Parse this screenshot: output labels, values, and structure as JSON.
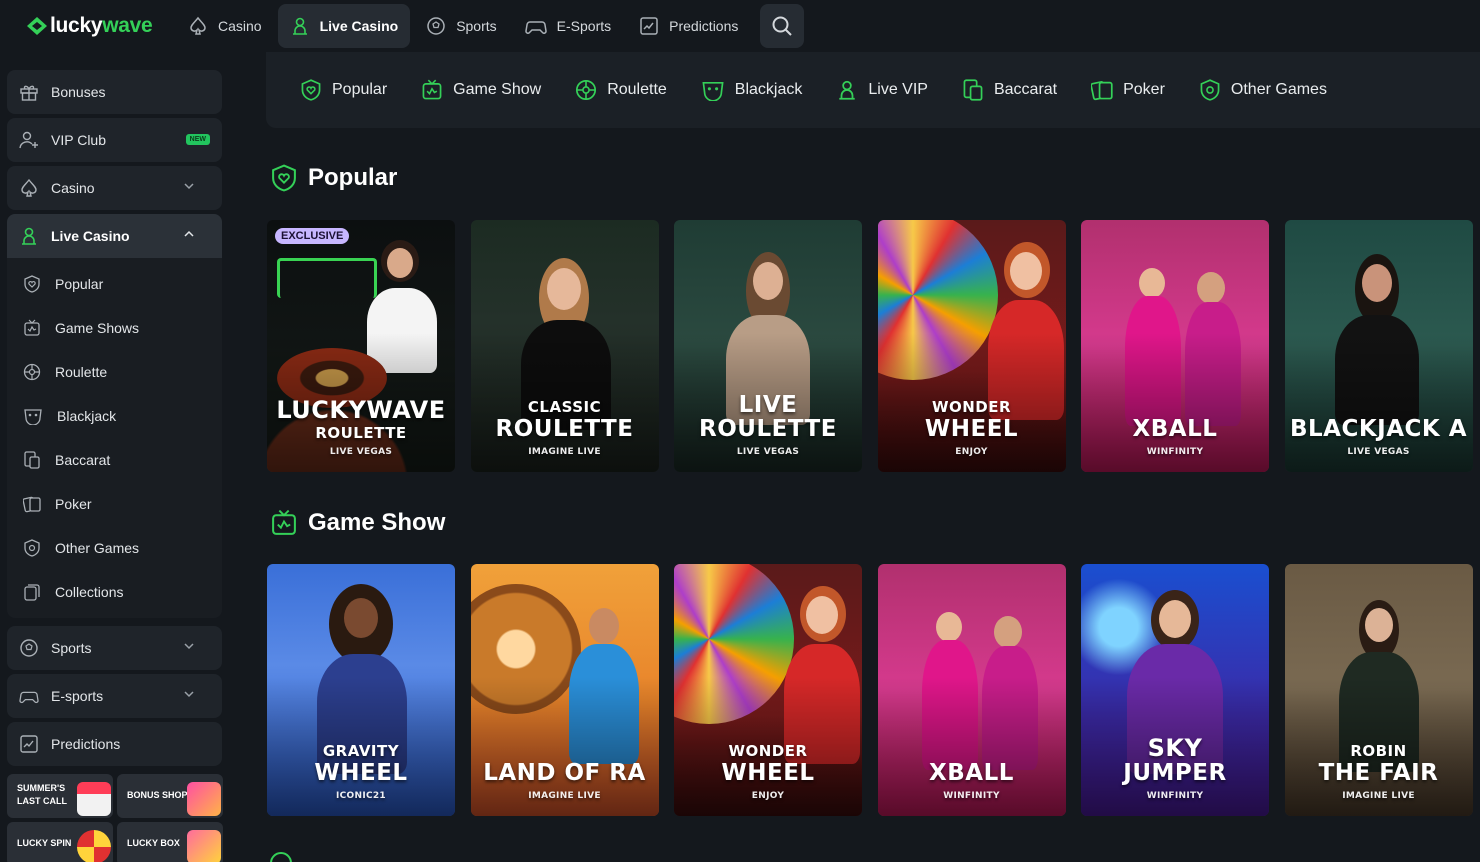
{
  "brand": {
    "part1": "lucky",
    "part2": "wave",
    "accent": "#34d058"
  },
  "topnav": [
    {
      "label": "Casino",
      "icon": "spade-icon"
    },
    {
      "label": "Live Casino",
      "icon": "dealer-icon",
      "active": true
    },
    {
      "label": "Sports",
      "icon": "football-icon"
    },
    {
      "label": "E-Sports",
      "icon": "gamepad-icon"
    },
    {
      "label": "Predictions",
      "icon": "chart-icon"
    }
  ],
  "sidebar": {
    "items": [
      {
        "label": "Bonuses",
        "icon": "gift-icon"
      },
      {
        "label": "VIP Club",
        "icon": "vip-icon",
        "badge": "NEW"
      },
      {
        "label": "Casino",
        "icon": "spade-icon"
      },
      {
        "label": "Live Casino",
        "icon": "dealer-icon"
      }
    ],
    "submenu": [
      {
        "label": "Popular",
        "icon": "heart-shield-icon"
      },
      {
        "label": "Game Shows",
        "icon": "tv-icon"
      },
      {
        "label": "Roulette",
        "icon": "roulette-icon"
      },
      {
        "label": "Blackjack",
        "icon": "blackjack-icon"
      },
      {
        "label": "Baccarat",
        "icon": "baccarat-icon"
      },
      {
        "label": "Poker",
        "icon": "poker-icon"
      },
      {
        "label": "Other Games",
        "icon": "other-games-icon"
      },
      {
        "label": "Collections",
        "icon": "collections-icon"
      }
    ],
    "bottom": [
      {
        "label": "Sports",
        "icon": "football-icon"
      },
      {
        "label": "E-sports",
        "icon": "gamepad-icon"
      },
      {
        "label": "Predictions",
        "icon": "chart-icon"
      }
    ],
    "promos": [
      {
        "line1": "SUMMER'S",
        "line2": "LAST CALL"
      },
      {
        "line1": "BONUS SHOP",
        "line2": ""
      },
      {
        "line1": "LUCKY SPIN",
        "line2": ""
      },
      {
        "line1": "LUCKY BOX",
        "line2": ""
      }
    ]
  },
  "categories": [
    "Popular",
    "Game Show",
    "Roulette",
    "Blackjack",
    "Live VIP",
    "Baccarat",
    "Poker",
    "Other Games"
  ],
  "sections": [
    {
      "title": "Popular",
      "cards": [
        {
          "t1": "",
          "t2": "LUCKYWAVE",
          "t2b": "ROULETTE",
          "t3": "LIVE VEGAS",
          "badge": "EXCLUSIVE"
        },
        {
          "t1": "CLASSIC",
          "t2": "ROULETTE",
          "t3": "IMAGINE LIVE"
        },
        {
          "t1": "LIVE",
          "t2": "ROULETTE",
          "t3": "LIVE VEGAS"
        },
        {
          "t1": "WONDER",
          "t2": "WHEEL",
          "t3": "ENJOY"
        },
        {
          "t1": "",
          "t2": "XBALL",
          "t3": "WINFINITY"
        },
        {
          "t1": "",
          "t2": "BLACKJACK A",
          "t3": "LIVE VEGAS"
        }
      ]
    },
    {
      "title": "Game Show",
      "cards": [
        {
          "t1": "GRAVITY",
          "t2": "WHEEL",
          "t3": "ICONIC21"
        },
        {
          "t1": "",
          "t2": "LAND OF RA",
          "t3": "IMAGINE LIVE"
        },
        {
          "t1": "WONDER",
          "t2": "WHEEL",
          "t3": "ENJOY"
        },
        {
          "t1": "",
          "t2": "XBALL",
          "t3": "WINFINITY"
        },
        {
          "t1": "SKY",
          "t2": "JUMPER",
          "t3": "WINFINITY"
        },
        {
          "t1": "ROBIN",
          "t2": "THE FAIR",
          "t3": "IMAGINE LIVE"
        }
      ]
    }
  ]
}
